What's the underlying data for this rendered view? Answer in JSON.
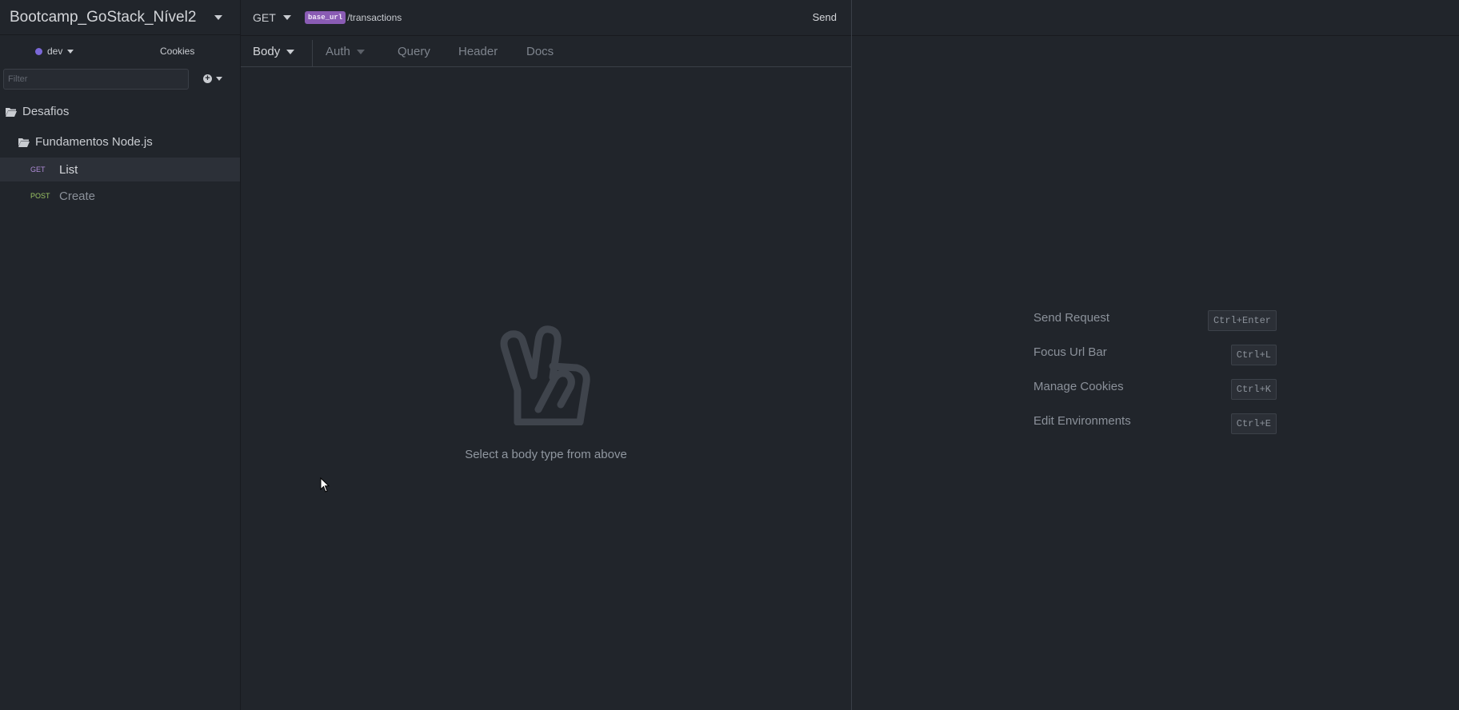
{
  "workspace": {
    "title": "Bootcamp_GoStack_Nível2"
  },
  "environment": {
    "name": "dev",
    "color": "#7b68d8"
  },
  "sidebar": {
    "cookies_label": "Cookies",
    "filter_placeholder": "Filter",
    "folders": [
      {
        "name": "Desafios"
      },
      {
        "name": "Fundamentos Node.js"
      }
    ],
    "requests": [
      {
        "method": "GET",
        "name": "List",
        "active": true
      },
      {
        "method": "POST",
        "name": "Create",
        "active": false
      }
    ]
  },
  "request": {
    "method": "GET",
    "url_variable": "base_url",
    "url_path": "/transactions",
    "send_label": "Send",
    "tabs": [
      {
        "label": "Body",
        "active": true
      },
      {
        "label": "Auth",
        "active": false
      },
      {
        "label": "Query",
        "active": false
      },
      {
        "label": "Header",
        "active": false
      },
      {
        "label": "Docs",
        "active": false
      }
    ],
    "empty_message": "Select a body type from above"
  },
  "shortcuts": [
    {
      "label": "Send Request",
      "keys": "Ctrl+Enter"
    },
    {
      "label": "Focus Url Bar",
      "keys": "Ctrl+L"
    },
    {
      "label": "Manage Cookies",
      "keys": "Ctrl+K"
    },
    {
      "label": "Edit Environments",
      "keys": "Ctrl+E"
    }
  ]
}
